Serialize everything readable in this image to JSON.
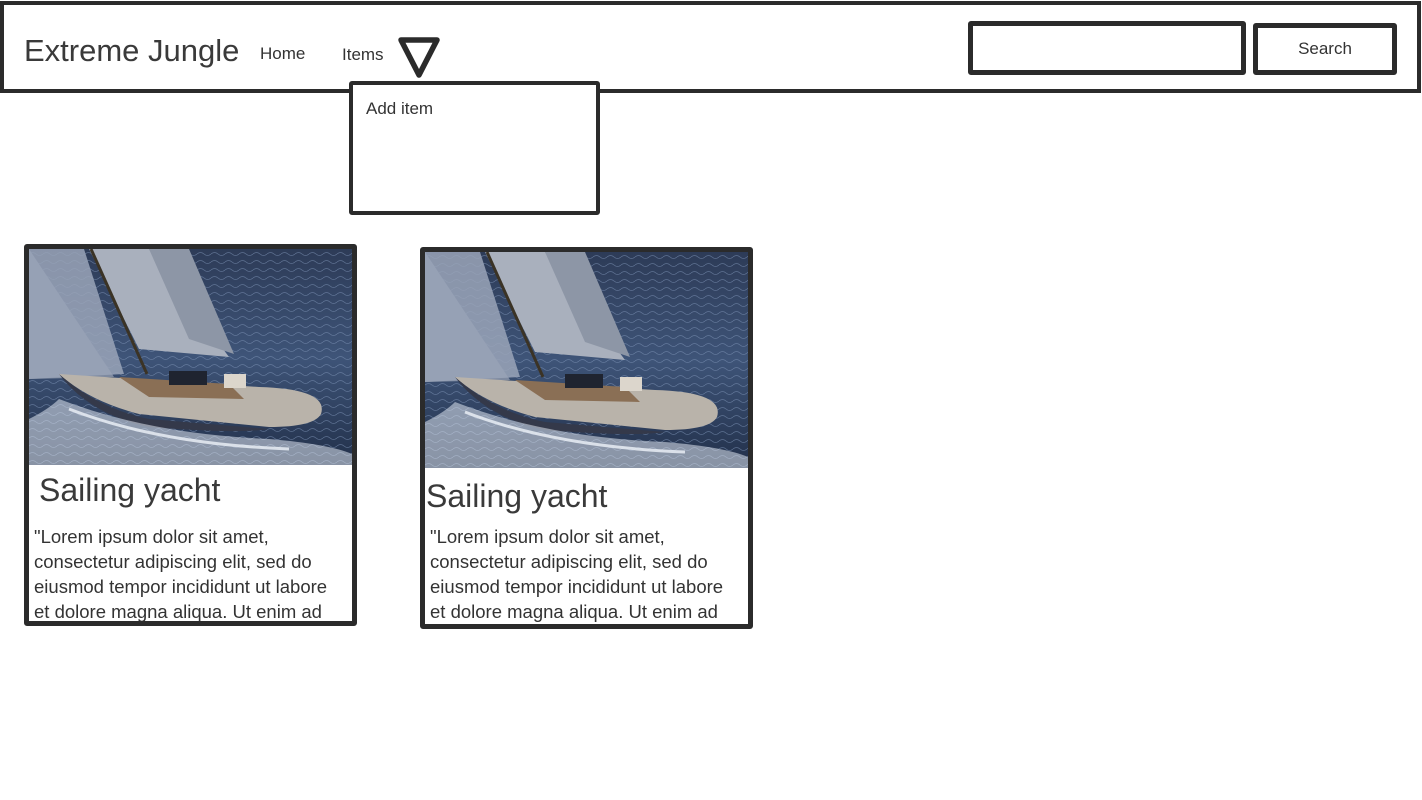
{
  "header": {
    "brand": "Extreme Jungle",
    "nav": {
      "home": "Home",
      "items": "Items"
    },
    "search": {
      "value": "",
      "placeholder": "",
      "button_label": "Search"
    }
  },
  "dropdown": {
    "items": [
      {
        "label": "Add item"
      }
    ]
  },
  "cards": [
    {
      "image": "sailing-yacht-photo",
      "title": "Sailing yacht",
      "text": "\"Lorem ipsum dolor sit amet, consectetur adipiscing elit, sed do eiusmod tempor incididunt ut labore et dolore magna aliqua. Ut enim ad"
    },
    {
      "image": "sailing-yacht-photo",
      "title": "Sailing yacht",
      "text": "\"Lorem ipsum dolor sit amet, consectetur adipiscing elit, sed do eiusmod tempor incididunt ut labore et dolore magna aliqua. Ut enim ad"
    }
  ]
}
